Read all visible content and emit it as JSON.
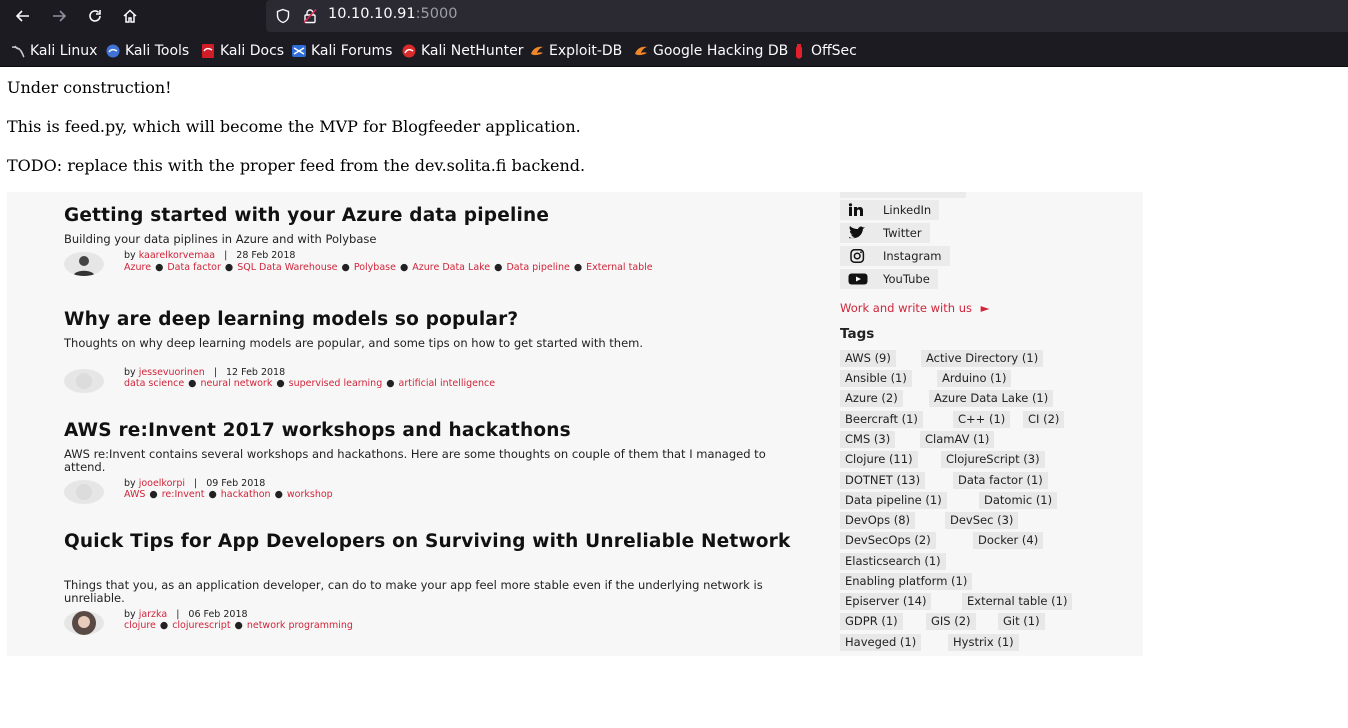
{
  "browser": {
    "url_host": "10.10.10.91",
    "url_port": ":5000",
    "bookmarks": [
      {
        "label": "Kali Linux",
        "icon": "kali-dragon-icon"
      },
      {
        "label": "Kali Tools",
        "icon": "kali-tools-icon"
      },
      {
        "label": "Kali Docs",
        "icon": "kali-docs-icon"
      },
      {
        "label": "Kali Forums",
        "icon": "kali-forums-icon"
      },
      {
        "label": "Kali NetHunter",
        "icon": "kali-nethunter-icon"
      },
      {
        "label": "Exploit-DB",
        "icon": "exploit-db-icon"
      },
      {
        "label": "Google Hacking DB",
        "icon": "ghdb-icon"
      },
      {
        "label": "OffSec",
        "icon": "offsec-icon"
      }
    ]
  },
  "page": {
    "line1": "Under construction!",
    "line2": "This is feed.py, which will become the MVP for Blogfeeder application.",
    "line3": "TODO: replace this with the proper feed from the dev.solita.fi backend."
  },
  "screenshot": {
    "posts": [
      {
        "title": "Getting started with your Azure data pipeline",
        "desc": "Building your data piplines in Azure and with Polybase",
        "by": "by",
        "author": "kaarelkorvemaa",
        "date": "28 Feb 2018",
        "tags": [
          "Azure",
          "Data factor",
          "SQL Data Warehouse",
          "Polybase",
          "Azure Data Lake",
          "Data pipeline",
          "External table"
        ]
      },
      {
        "title": "Why are deep learning models so popular?",
        "desc": "Thoughts on why deep learning models are popular, and some tips on how to get started with them.",
        "by": "by",
        "author": "jessevuorinen",
        "date": "12 Feb 2018",
        "tags": [
          "data science",
          "neural network",
          "supervised learning",
          "artificial intelligence"
        ]
      },
      {
        "title": "AWS re:Invent 2017 workshops and hackathons",
        "desc": "AWS re:Invent contains several workshops and hackathons. Here are some thoughts on couple of them that I managed to attend.",
        "by": "by",
        "author": "jooelkorpi",
        "date": "09 Feb 2018",
        "tags": [
          "AWS",
          "re:Invent",
          "hackathon",
          "workshop"
        ]
      },
      {
        "title": "Quick Tips for App Developers on Surviving with Unreliable Network",
        "desc": "Things that you, as an application developer, can do to make your app feel more stable even if the underlying network is unreliable.",
        "by": "by",
        "author": "jarzka",
        "date": "06 Feb 2018",
        "tags": [
          "clojure",
          "clojurescript",
          "network programming"
        ]
      }
    ],
    "social": [
      {
        "label": "LinkedIn",
        "icon": "linkedin-icon"
      },
      {
        "label": "Twitter",
        "icon": "twitter-icon"
      },
      {
        "label": "Instagram",
        "icon": "instagram-icon"
      },
      {
        "label": "YouTube",
        "icon": "youtube-icon"
      }
    ],
    "work_link": "Work and write with us",
    "tags_heading": "Tags",
    "tag_rows": [
      [
        "AWS (9)",
        "Active Directory (1)"
      ],
      [
        "Ansible (1)",
        "Arduino (1)"
      ],
      [
        "Azure (2)",
        "Azure Data Lake (1)"
      ],
      [
        "Beercraft (1)",
        "C++ (1)",
        "CI (2)"
      ],
      [
        "CMS (3)",
        "ClamAV (1)"
      ],
      [
        "Clojure (11)",
        "ClojureScript (3)"
      ],
      [
        "DOTNET (13)",
        "Data factor (1)"
      ],
      [
        "Data pipeline (1)",
        "Datomic (1)"
      ],
      [
        "DevOps (8)",
        "DevSec (3)"
      ],
      [
        "DevSecOps (2)",
        "Docker (4)"
      ],
      [
        "Elasticsearch (1)"
      ],
      [
        "Enabling platform (1)"
      ],
      [
        "Episerver (14)",
        "External table (1)"
      ],
      [
        "GDPR (1)",
        "GIS (2)",
        "Git (1)"
      ],
      [
        "Haveged (1)",
        "Hystrix (1)"
      ]
    ]
  }
}
